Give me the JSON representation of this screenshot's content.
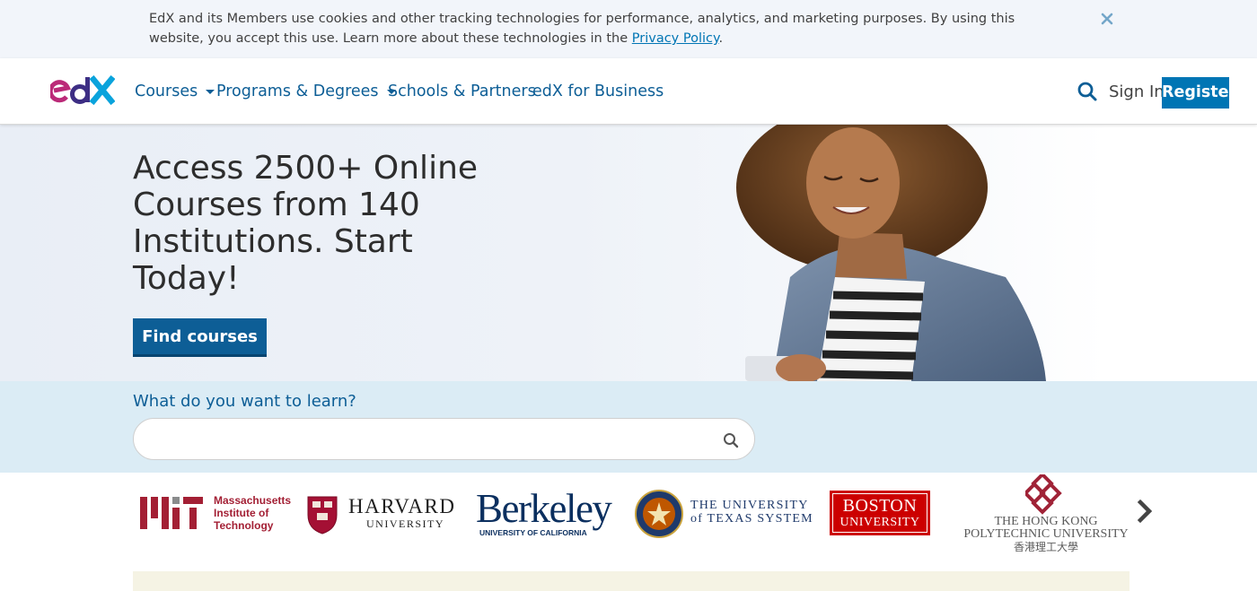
{
  "cookie_banner": {
    "text": "EdX and its Members use cookies and other tracking technologies for performance, analytics, and marketing purposes. By using this website, you accept this use. Learn more about these technologies in the ",
    "link_text": "Privacy Policy",
    "suffix": "."
  },
  "header": {
    "logo_text": "edX",
    "nav": [
      {
        "label": "Courses",
        "has_dropdown": true
      },
      {
        "label": "Programs & Degrees",
        "has_dropdown": true
      },
      {
        "label": "Schools & Partners",
        "has_dropdown": false
      },
      {
        "label": "edX for Business",
        "has_dropdown": false
      }
    ],
    "sign_in": "Sign In",
    "register": "Register"
  },
  "hero": {
    "title": "Access 2500+ Online Courses from 140 Institutions. Start Today!",
    "button": "Find courses"
  },
  "search": {
    "label": "What do you want to learn?",
    "placeholder": "",
    "value": ""
  },
  "partners": [
    {
      "name": "MIT",
      "text_lines": [
        "Massachusetts",
        "Institute of",
        "Technology"
      ]
    },
    {
      "name": "Harvard",
      "text_lines": [
        "HARVARD",
        "UNIVERSITY"
      ]
    },
    {
      "name": "Berkeley",
      "text_lines": [
        "Berkeley",
        "UNIVERSITY OF CALIFORNIA"
      ]
    },
    {
      "name": "UT System",
      "text_lines": [
        "THE UNIVERSITY",
        "of TEXAS SYSTEM"
      ]
    },
    {
      "name": "Boston University",
      "text_lines": [
        "BOSTON",
        "UNIVERSITY"
      ]
    },
    {
      "name": "Hong Kong PolyU",
      "text_lines": [
        "THE HONG KONG",
        "POLYTECHNIC UNIVERSITY",
        "香港理工大學"
      ]
    }
  ],
  "colors": {
    "brand_blue": "#0075b4",
    "nav_blue": "#0d5e96",
    "logo_magenta": "#bb2a78",
    "mit_red": "#a31f34",
    "harvard_crimson": "#a41034",
    "berkeley_navy": "#0b2f5f",
    "bu_red": "#cc0000",
    "polyu_red": "#a02337"
  }
}
